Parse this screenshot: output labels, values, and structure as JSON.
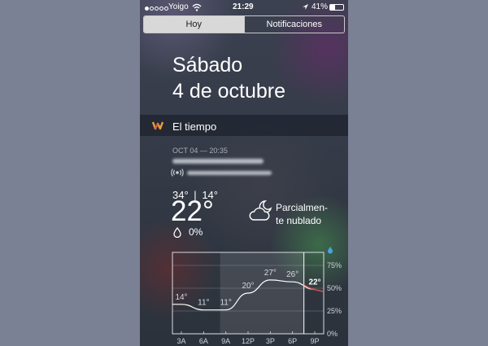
{
  "status": {
    "carrier": "Yoigo",
    "time": "21:29",
    "battery": "41%",
    "signal_dots": [
      true,
      false,
      false,
      false,
      false
    ]
  },
  "tabs": [
    {
      "label": "Hoy",
      "active": true
    },
    {
      "label": "Notificaciones",
      "active": false
    }
  ],
  "date": {
    "weekday": "Sábado",
    "full_date": "4 de octubre"
  },
  "widget": {
    "title": "El tiempo",
    "timestamp": "OCT 04 — 20:35",
    "high": "34°",
    "separator": "|",
    "low": "14°",
    "current_temp": "22°",
    "precip": "0%",
    "condition_line1": "Parcialmen-",
    "condition_line2": "te nublado",
    "icons": [
      "weather-underground-logo",
      "location-icon",
      "radio-signal-icon",
      "raindrop-icon",
      "partly-cloudy-night-icon",
      "raindrop-legend-icon"
    ]
  },
  "chart_data": {
    "type": "line",
    "categories": [
      "3A",
      "6A",
      "9A",
      "12P",
      "3P",
      "6P",
      "9P"
    ],
    "series": [
      {
        "values": [
          14,
          11,
          11,
          20,
          27,
          26,
          22
        ]
      }
    ],
    "point_labels": [
      "14°",
      "11°",
      "11°",
      "20°",
      "27°",
      "26°",
      "22°"
    ],
    "right_axis_ticks": [
      "75%",
      "50%",
      "25%",
      "0%"
    ],
    "ylim": [
      0,
      40
    ],
    "colors": {
      "line": "#ffffff",
      "forecast": "#d9534f",
      "rain_icon": "#4aa3df"
    }
  }
}
